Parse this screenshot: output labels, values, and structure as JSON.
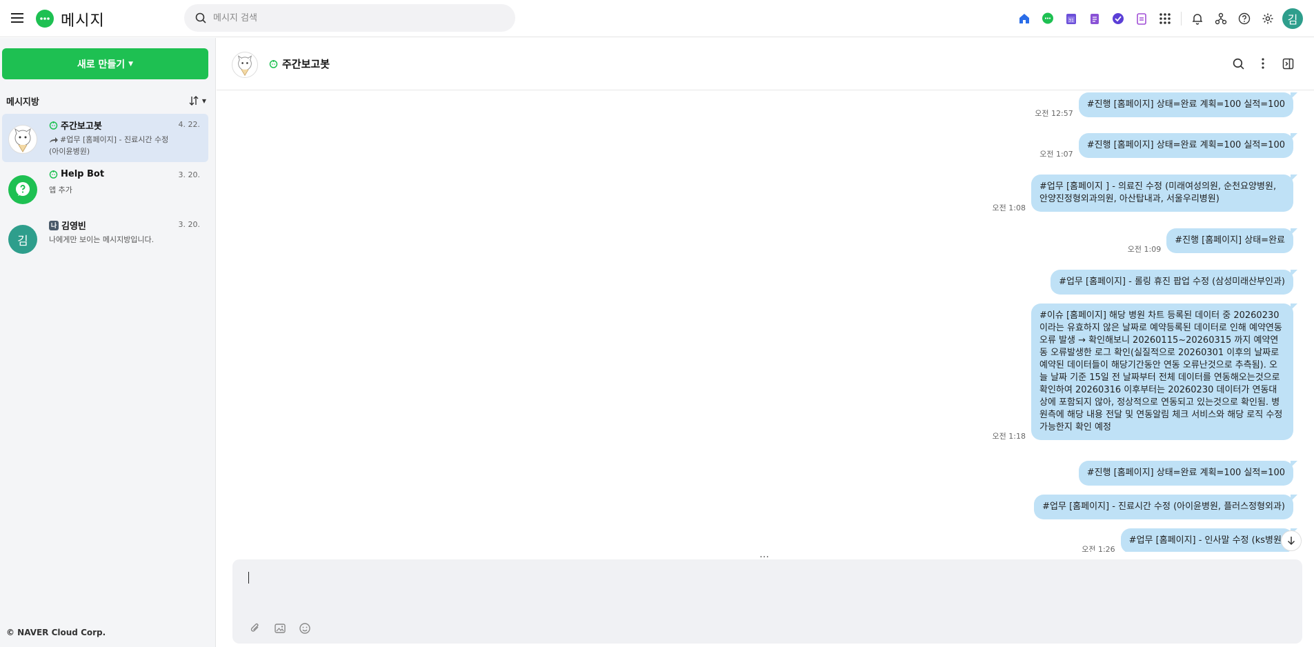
{
  "app": {
    "title": "메시지"
  },
  "search": {
    "placeholder": "메시지 검색"
  },
  "user": {
    "initial": "김"
  },
  "sidebar": {
    "new_button": "새로 만들기",
    "rooms_title": "메시지방",
    "rooms": [
      {
        "name": "주간보고봇",
        "date": "4. 22.",
        "preview": "#업무 [홈페이지] - 진료시간 수정 (아이윤병원)",
        "active": true
      },
      {
        "name": "Help Bot",
        "date": "3. 20.",
        "preview": "앱 추가",
        "active": false
      },
      {
        "name": "김영빈",
        "date": "3. 20.",
        "preview": "나에게만 보이는 메시지방입니다.",
        "tag": "나",
        "initial": "김",
        "active": false
      }
    ],
    "footer": "© NAVER Cloud Corp."
  },
  "chat": {
    "title": "주간보고봇",
    "messages": [
      {
        "time": "오전 12:57",
        "text": "#진행 [홈페이지] 상태=완료 계획=100 실적=100"
      },
      {
        "time": "오전 1:07",
        "text": "#진행 [홈페이지] 상태=완료 계획=100 실적=100"
      },
      {
        "time": "오전 1:08",
        "text": "#업무 [홈페이지 ] - 의료진 수정 (미래여성의원, 순천요양병원, 안양진정형외과의원, 아산탑내과, 서울우리병원)"
      },
      {
        "time": "오전 1:09",
        "text": "#진행 [홈페이지] 상태=완료"
      },
      {
        "time": "",
        "text": "#업무 [홈페이지] - 롤링 휴진 팝업 수정 (삼성미래산부인과)"
      },
      {
        "time": "오전 1:18",
        "text": "#이슈 [홈페이지] 해당 병원 차트 등록된 데이터 중 20260230 이라는 유효하지 않은 날짜로 예약등록된 데이터로 인해 예약연동 오류 발생 → 확인해보니 20260115~20260315 까지 예약연동 오류발생한 로그 확인(실질적으로 20260301 이후의 날짜로 예약된 데이터들이 해당기간동안 연동 오류난것으로 추측됨). 오늘 날짜 기준 15일 전 날짜부터 전체 데이터를 연동해오는것으로 확인하여 20260316 이후부터는 20260230 데이터가 연동대상에 포함되지 않아, 정상적으로 연동되고 있는것으로 확인됨. 병원측에 해당 내용 전달 및 연동알림 체크 서비스와 해당 로직 수정 가능한지 확인 예정"
      },
      {
        "time": "",
        "text": "#진행 [홈페이지] 상태=완료 계획=100 실적=100"
      },
      {
        "time": "",
        "text": "#업무 [홈페이지] - 진료시간 수정 (아이윤병원, 플러스정형외과)"
      },
      {
        "time": "오전 1:26",
        "text": "#업무 [홈페이지] - 인사말 수정 (ks병원)"
      }
    ]
  },
  "colors": {
    "brand": "#1ec052",
    "bubble": "#bfe1f6",
    "active_room": "#dde7f5"
  }
}
